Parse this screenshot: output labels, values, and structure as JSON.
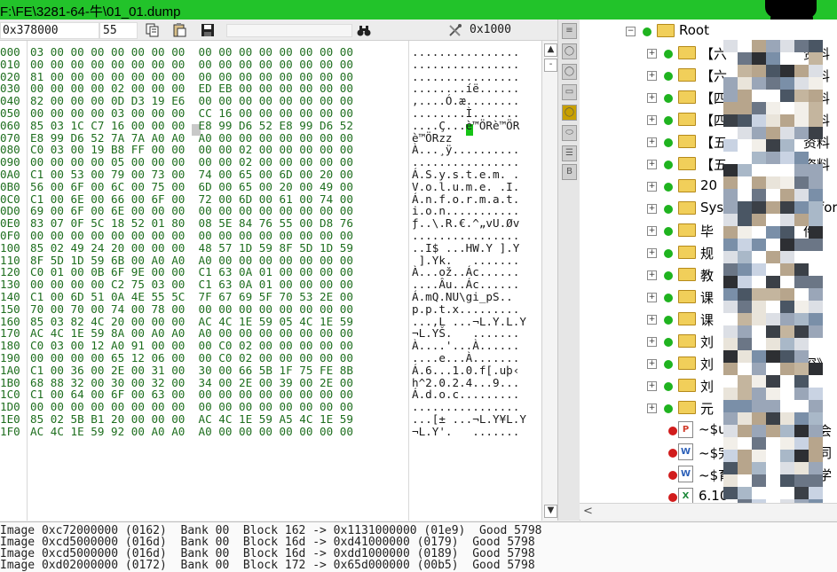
{
  "window": {
    "title": "F:\\FE\\3281-64-牛\\01_01.dump"
  },
  "toolbar": {
    "address": "0x378000",
    "count": "55",
    "goto_value": "0x1000"
  },
  "hex": {
    "offsets": [
      "000",
      "010",
      "020",
      "030",
      "040",
      "050",
      "060",
      "070",
      "080",
      "090",
      "0A0",
      "0B0",
      "0C0",
      "0D0",
      "0E0",
      "0F0",
      "100",
      "110",
      "120",
      "130",
      "140",
      "150",
      "160",
      "170",
      "180",
      "190",
      "1A0",
      "1B0",
      "1C0",
      "1D0",
      "1E0",
      "1F0"
    ],
    "rows": [
      "03 00 00 00 00 00 00 00  00 00 00 00 00 00 00 00",
      "00 00 00 00 00 00 00 00  00 00 00 00 00 00 00 00",
      "81 00 00 00 00 00 00 00  00 00 00 00 00 00 00 00",
      "00 00 00 00 02 00 00 00  ED EB 00 00 00 00 00 00",
      "82 00 00 00 0D D3 19 E6  00 00 00 00 00 00 00 00",
      "00 00 00 00 03 00 00 00  CC 16 00 00 00 00 00 00",
      "85 03 1C C7 16 00 00 00  E8 99 D6 52 E8 99 D6 52",
      "E8 99 D6 52 7A 7A A0 A0  A0 00 00 00 00 00 00 00",
      "C0 03 00 19 B8 FF 00 00  00 00 02 00 00 00 00 00",
      "00 00 00 00 05 00 00 00  00 00 02 00 00 00 00 00",
      "C1 00 53 00 79 00 73 00  74 00 65 00 6D 00 20 00",
      "56 00 6F 00 6C 00 75 00  6D 00 65 00 20 00 49 00",
      "C1 00 6E 00 66 00 6F 00  72 00 6D 00 61 00 74 00",
      "69 00 6F 00 6E 00 00 00  00 00 00 00 00 00 00 00",
      "83 07 0F 5C 18 52 01 80  08 5E 84 76 55 00 D8 76",
      "00 00 00 00 00 00 00 00  00 00 00 00 00 00 00 00",
      "85 02 49 24 20 00 00 00  48 57 1D 59 8F 5D 1D 59",
      "8F 5D 1D 59 6B 00 A0 A0  A0 00 00 00 00 00 00 00",
      "C0 01 00 0B 6F 9E 00 00  C1 63 0A 01 00 00 00 00",
      "00 00 00 00 C2 75 03 00  C1 63 0A 01 00 00 00 00",
      "C1 00 6D 51 0A 4E 55 5C  7F 67 69 5F 70 53 2E 00",
      "70 00 70 00 74 00 78 00  00 00 00 00 00 00 00 00",
      "85 03 82 4C 20 00 00 00  AC 4C 1E 59 05 4C 1E 59",
      "AC 4C 1E 59 8A 00 A0 A0  A0 00 00 00 00 00 00 00",
      "C0 03 00 12 A0 91 00 00  00 C0 02 00 00 00 00 00",
      "00 00 00 00 65 12 06 00  00 C0 02 00 00 00 00 00",
      "C1 00 36 00 2E 00 31 00  30 00 66 5B 1F 75 FE 8B",
      "68 88 32 00 30 00 32 00  34 00 2E 00 39 00 2E 00",
      "C1 00 64 00 6F 00 63 00  00 00 00 00 00 00 00 00",
      "00 00 00 00 00 00 00 00  00 00 00 00 00 00 00 00",
      "85 02 5B B1 20 00 00 00  AC 4C 1E 59 A5 4C 1E 59",
      "AC 4C 1E 59 92 00 A0 A0  A0 00 00 00 00 00 00 00"
    ],
    "ascii": [
      "................",
      "................",
      "................",
      "........íë......",
      ",....Ó.æ........",
      "........Ì.......",
      "....Ç...è™ÖRè™ÖR",
      "è™ÖRzz          ",
      "À...¸ÿ..........",
      "................",
      "Á.S.y.s.t.e.m. .",
      "V.o.l.u.m.e. .I.",
      "Á.n.f.o.r.m.a.t.",
      "i.o.n...........",
      "ƒ..\\.R.€.^„vU.Øv",
      "................",
      "..I$ ...HW.Y ].Y",
      " ].Yk.   .......",
      "À...ož..Ác......",
      "....Âu..Ác......",
      "Á.mQ.NU\\gi_pS..",
      "p.p.t.x.........",
      "...,L ...¬L.Y.L.Y",
      "¬L.YŠ.   .......",
      "À....'...À......",
      "....e...À.......",
      "Á.6...1.0.f[.uþ‹",
      "h^2.0.2.4...9...",
      "Á.d.o.c.........",
      "................",
      "...[± ...¬L.Y¥L.Y",
      "¬L.Y'.   ......."
    ]
  },
  "tree": {
    "root": "Root",
    "folders": [
      "【六",
      "【六",
      "【四",
      "【四",
      "【五",
      "【五",
      "20",
      "Sys",
      "毕",
      "规",
      "教",
      "课",
      "课",
      "刘",
      "刘",
      "刘",
      "元"
    ],
    "right_text": [
      "资料",
      "资料",
      "资料",
      "资料",
      "资料",
      "资料",
      "",
      "Infor",
      "件",
      "",
      "",
      "",
      "",
      "",
      "深》",
      "",
      ""
    ],
    "files": [
      {
        "name": "~$u",
        "badge": "P",
        "right": "长会"
      },
      {
        "name": "~$完",
        "badge": "W",
        "right": "请同"
      },
      {
        "name": "~$育",
        "badge": "W",
        "right": "理学"
      },
      {
        "name": "6.10",
        "badge": "X",
        "right": "报"
      }
    ]
  },
  "log": [
    "Image 0xc72000000 (0162)  Bank 00  Block 162 -> 0x1131000000 (01e9)  Good 5798",
    "Image 0xcd5000000 (016d)  Bank 00  Block 16d -> 0xd41000000 (0179)  Good 5798",
    "Image 0xcd5000000 (016d)  Bank 00  Block 16d -> 0xdd1000000 (0189)  Good 5798",
    "Image 0xd02000000 (0172)  Bank 00  Block 172 -> 0x65d000000 (00b5)  Good 5798"
  ]
}
